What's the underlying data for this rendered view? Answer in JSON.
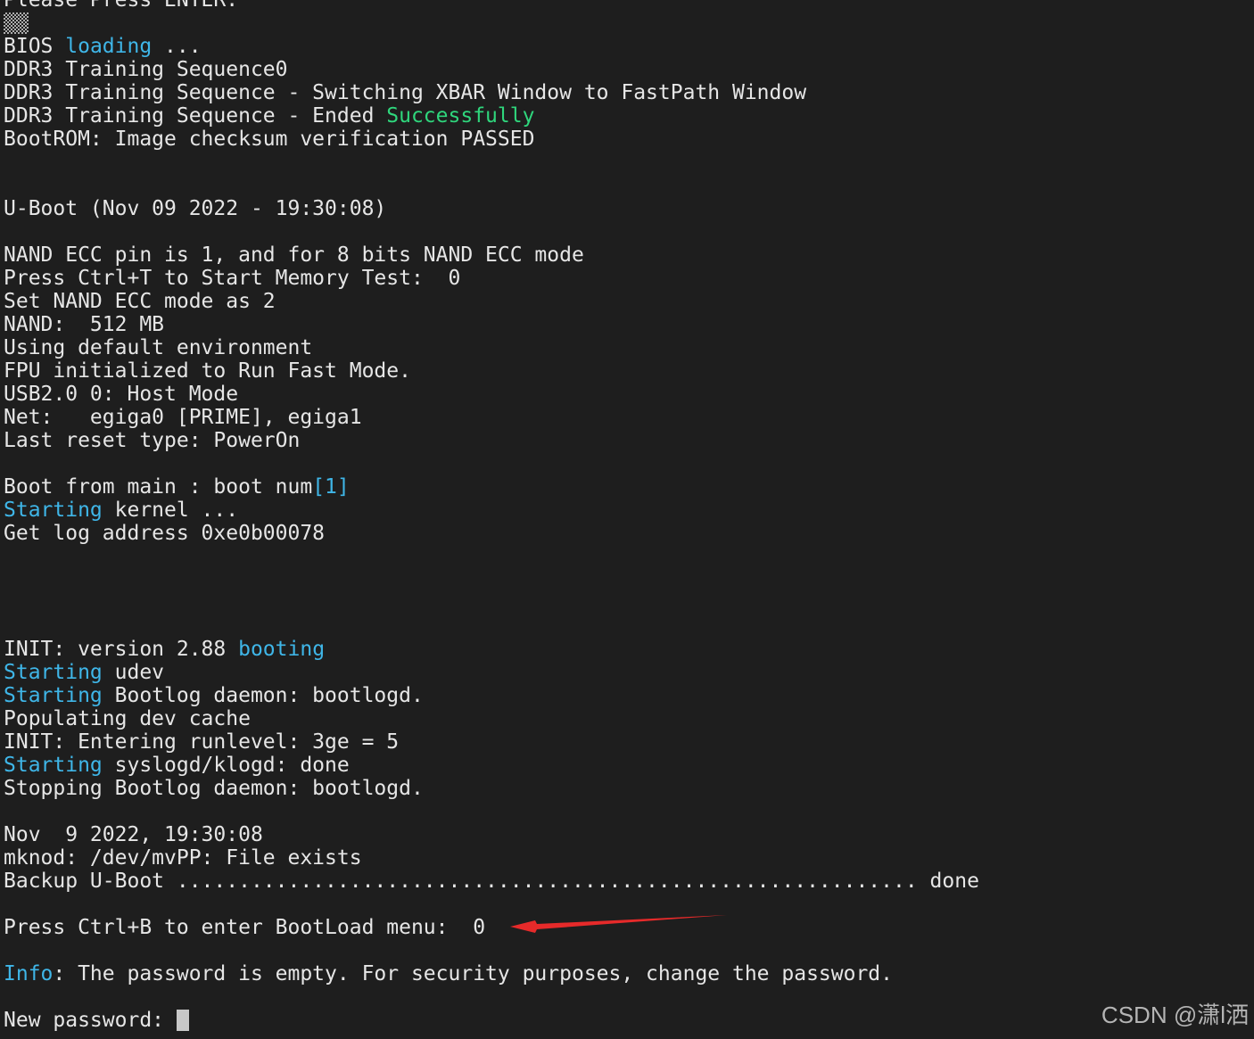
{
  "colors": {
    "background": "#1e1e1e",
    "text": "#e6e6e6",
    "highlight_blue": "#3fb6e8",
    "highlight_green": "#2fd67c",
    "arrow": "#e62a2a"
  },
  "lines": [
    {
      "segments": [
        {
          "text": "Please Press ENTER."
        }
      ]
    },
    {
      "segments": [
        {
          "text": "▒▒"
        }
      ],
      "block_glyph": true
    },
    {
      "segments": [
        {
          "text": "BIOS "
        },
        {
          "text": "loading",
          "c": "blue"
        },
        {
          "text": " ..."
        }
      ]
    },
    {
      "segments": [
        {
          "text": "DDR3 Training Sequence0"
        }
      ]
    },
    {
      "segments": [
        {
          "text": "DDR3 Training Sequence - Switching XBAR Window to FastPath Window"
        }
      ]
    },
    {
      "segments": [
        {
          "text": "DDR3 Training Sequence - Ended "
        },
        {
          "text": "Successfully",
          "c": "green"
        }
      ]
    },
    {
      "segments": [
        {
          "text": "BootROM: Image checksum verification PASSED"
        }
      ]
    },
    {
      "segments": []
    },
    {
      "segments": []
    },
    {
      "segments": [
        {
          "text": "U-Boot (Nov 09 2022 - 19:30:08)"
        }
      ]
    },
    {
      "segments": []
    },
    {
      "segments": [
        {
          "text": "NAND ECC pin is 1, and for 8 bits NAND ECC mode"
        }
      ]
    },
    {
      "segments": [
        {
          "text": "Press Ctrl+T to Start Memory Test:  0"
        }
      ]
    },
    {
      "segments": [
        {
          "text": "Set NAND ECC mode as 2"
        }
      ]
    },
    {
      "segments": [
        {
          "text": "NAND:  512 MB"
        }
      ]
    },
    {
      "segments": [
        {
          "text": "Using default environment"
        }
      ]
    },
    {
      "segments": [
        {
          "text": "FPU initialized to Run Fast Mode."
        }
      ]
    },
    {
      "segments": [
        {
          "text": "USB2.0 0: Host Mode"
        }
      ]
    },
    {
      "segments": [
        {
          "text": "Net:   egiga0 [PRIME], egiga1"
        }
      ]
    },
    {
      "segments": [
        {
          "text": "Last reset type: PowerOn"
        }
      ]
    },
    {
      "segments": []
    },
    {
      "segments": [
        {
          "text": "Boot from main : boot num"
        },
        {
          "text": "[1]",
          "c": "blue"
        }
      ]
    },
    {
      "segments": [
        {
          "text": "Starting",
          "c": "blue"
        },
        {
          "text": " kernel ..."
        }
      ]
    },
    {
      "segments": [
        {
          "text": "Get log address 0xe0b00078"
        }
      ]
    },
    {
      "segments": []
    },
    {
      "segments": []
    },
    {
      "segments": []
    },
    {
      "segments": []
    },
    {
      "segments": [
        {
          "text": "INIT: version 2.88 "
        },
        {
          "text": "booting",
          "c": "blue"
        }
      ]
    },
    {
      "segments": [
        {
          "text": "Starting",
          "c": "blue"
        },
        {
          "text": " udev"
        }
      ]
    },
    {
      "segments": [
        {
          "text": "Starting",
          "c": "blue"
        },
        {
          "text": " Bootlog daemon: bootlogd."
        }
      ]
    },
    {
      "segments": [
        {
          "text": "Populating dev cache"
        }
      ]
    },
    {
      "segments": [
        {
          "text": "INIT: Entering runlevel: 3ge = 5"
        }
      ]
    },
    {
      "segments": [
        {
          "text": "Starting",
          "c": "blue"
        },
        {
          "text": " syslogd/klogd: done"
        }
      ]
    },
    {
      "segments": [
        {
          "text": "Stopping Bootlog daemon: bootlogd."
        }
      ]
    },
    {
      "segments": []
    },
    {
      "segments": [
        {
          "text": "Nov  9 2022, 19:30:08"
        }
      ]
    },
    {
      "segments": [
        {
          "text": "mknod: /dev/mvPP: File exists"
        }
      ]
    },
    {
      "segments": [
        {
          "text": "Backup U-Boot ............................................................ done"
        }
      ]
    },
    {
      "segments": []
    },
    {
      "segments": [
        {
          "text": "Press Ctrl+B to enter BootLoad menu:  0"
        }
      ]
    },
    {
      "segments": []
    },
    {
      "segments": [
        {
          "text": "Info",
          "c": "blue"
        },
        {
          "text": ": The password is empty. For security purposes, change the password."
        }
      ]
    },
    {
      "segments": []
    },
    {
      "segments": [
        {
          "text": "New password: "
        }
      ],
      "cursor": true
    }
  ],
  "watermark": "CSDN @潇l洒",
  "annotation": {
    "icon": "red-arrow-icon"
  }
}
